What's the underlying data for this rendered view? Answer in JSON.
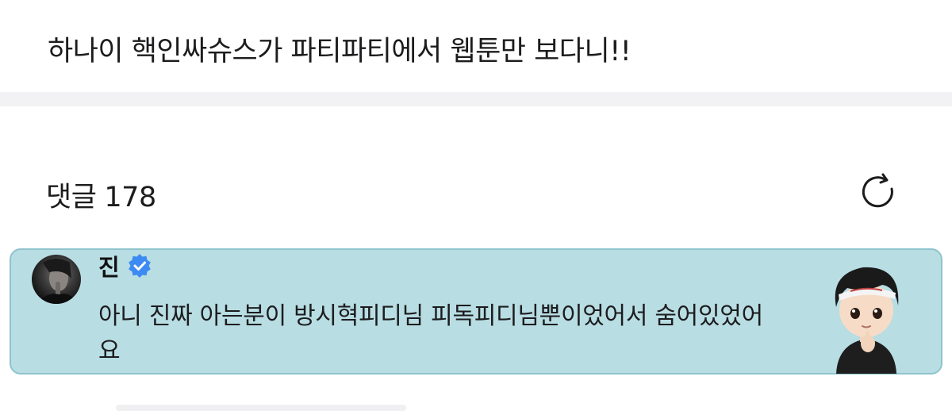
{
  "post": {
    "title": "하나이 핵인싸슈스가 파티파티에서 웹툰만 보다니!!"
  },
  "comments": {
    "label": "댓글",
    "count": "178",
    "refresh_icon": "refresh-icon"
  },
  "featured_comment": {
    "author": "진",
    "verified_icon": "verified-badge-icon",
    "verified_color": "#3d8bf2",
    "text": "아니 진짜 아는분이 방시혁피디님 피독피디님뿐이었어서 숨어있었어요",
    "background": "#b8dde3",
    "sticker_icon": "character-sticker"
  }
}
